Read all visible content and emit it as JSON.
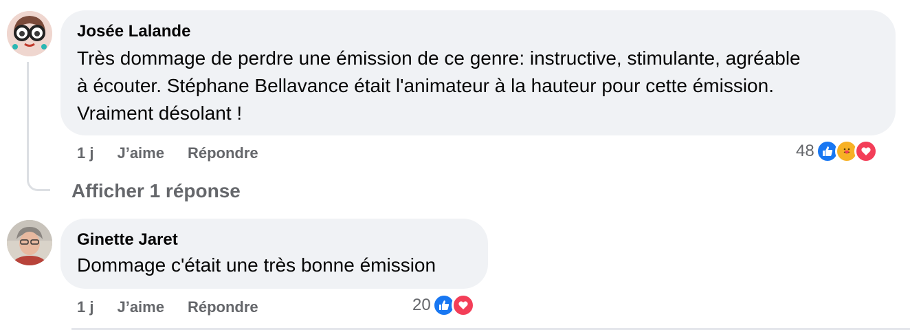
{
  "comments": [
    {
      "author": "Josée Lalande",
      "lines": [
        "Très dommage de perdre une émission de ce genre: instructive, stimulante, agréable",
        "à écouter. Stéphane Bellavance était l'animateur à la hauteur pour cette émission.",
        "Vraiment désolant !"
      ],
      "time": "1 j",
      "like_label": "J’aime",
      "reply_label": "Répondre",
      "reaction_count": "48",
      "reactions": [
        "like-icon",
        "care-icon",
        "love-icon"
      ],
      "show_replies": "Afficher 1 réponse"
    },
    {
      "author": "Ginette Jaret",
      "lines": [
        "Dommage c'était une très bonne émission"
      ],
      "time": "1 j",
      "like_label": "J’aime",
      "reply_label": "Répondre",
      "reaction_count": "20",
      "reactions": [
        "like-icon",
        "love-icon"
      ]
    }
  ],
  "colors": {
    "bubble": "#f0f2f5",
    "meta_text": "#65676b",
    "like": "#1877f2",
    "love": "#f33e58",
    "care": "#f7b125"
  }
}
